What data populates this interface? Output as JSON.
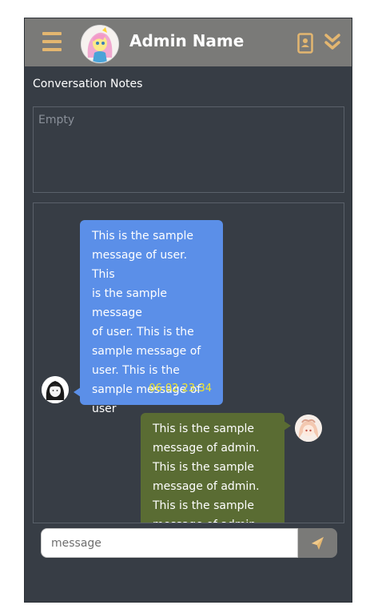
{
  "header": {
    "admin_name": "Admin Name",
    "menu_icon": "hamburger-menu-icon",
    "contact_icon": "contact-card-icon",
    "collapse_icon": "double-chevron-down-icon",
    "accent_color": "#e3b670"
  },
  "notes": {
    "title": "Conversation Notes",
    "placeholder": "Empty"
  },
  "messages": [
    {
      "sender": "user",
      "lines": [
        "This is the sample",
        "message of user. This",
        "is the sample message",
        "of user. This is the",
        "sample message of",
        "user. This is the",
        "sample message of",
        "user"
      ],
      "time": "06.02 23:34",
      "color": "#5b8fe8"
    },
    {
      "sender": "admin",
      "lines": [
        "This is the sample",
        "message of admin.",
        "This is the sample",
        "message of admin.",
        "This is the sample",
        "message of admin."
      ],
      "color": "#5a6c33"
    }
  ],
  "composer": {
    "placeholder": "message",
    "send_icon": "paper-plane-send-icon"
  }
}
